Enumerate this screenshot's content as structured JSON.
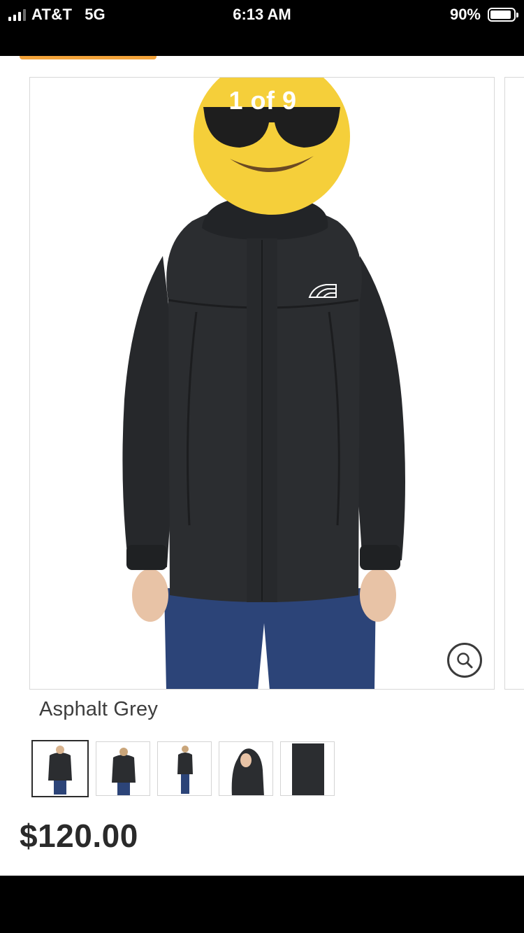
{
  "status_bar": {
    "carrier": "AT&T",
    "network": "5G",
    "time": "6:13 AM",
    "battery_percent": "90%",
    "battery_level": 0.9
  },
  "gallery": {
    "counter": "1 of 9",
    "zoom_icon": "magnifier-icon",
    "thumbnail_count": 5,
    "selected_thumbnail": 0
  },
  "product": {
    "color_name": "Asphalt Grey",
    "price": "$120.00",
    "logo_text": "THE NORTH FACE"
  },
  "colors": {
    "jacket": "#2b2d30",
    "pants": "#2c4478",
    "emoji_face": "#f5cf3a",
    "accent_orange": "#f3a33a"
  }
}
